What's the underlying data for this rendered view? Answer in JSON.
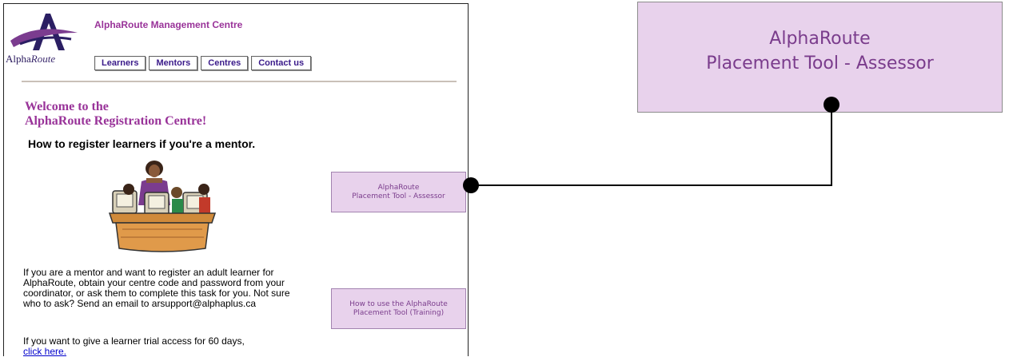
{
  "header": {
    "logo_alt": "AlphaRoute logo",
    "logo_text_a": "Alpha",
    "logo_text_b": "Route",
    "site_title": "AlphaRoute Management Centre"
  },
  "nav": {
    "tabs": [
      {
        "label": "Learners"
      },
      {
        "label": "Mentors"
      },
      {
        "label": "Centres"
      },
      {
        "label": "Contact us"
      }
    ]
  },
  "main": {
    "welcome_line1": "Welcome to the",
    "welcome_line2": "AlphaRoute Registration Centre!",
    "howto_heading": "How to register learners if you're a mentor.",
    "mentor_paragraph": "If you are a mentor and want to register an adult learner for AlphaRoute, obtain your centre code and password from your coordinator, or ask them to complete this task for you. Not sure who to ask? Send an email to arsupport@alphaplus.ca",
    "trial_text": "If you want to give a learner trial access for 60 days,",
    "trial_link": "click here."
  },
  "side_buttons": {
    "assessor_line1": "AlphaRoute",
    "assessor_line2": "Placement Tool - Assessor",
    "training_line1": "How to use the AlphaRoute",
    "training_line2": "Placement Tool (Training)"
  },
  "callout": {
    "line1": "AlphaRoute",
    "line2": "Placement Tool - Assessor"
  },
  "colors": {
    "title_purple": "#993399",
    "button_bg": "#e8d2ec",
    "button_text": "#7a3c8c",
    "nav_text": "#3a1a8a",
    "link_blue": "#0000cc"
  }
}
